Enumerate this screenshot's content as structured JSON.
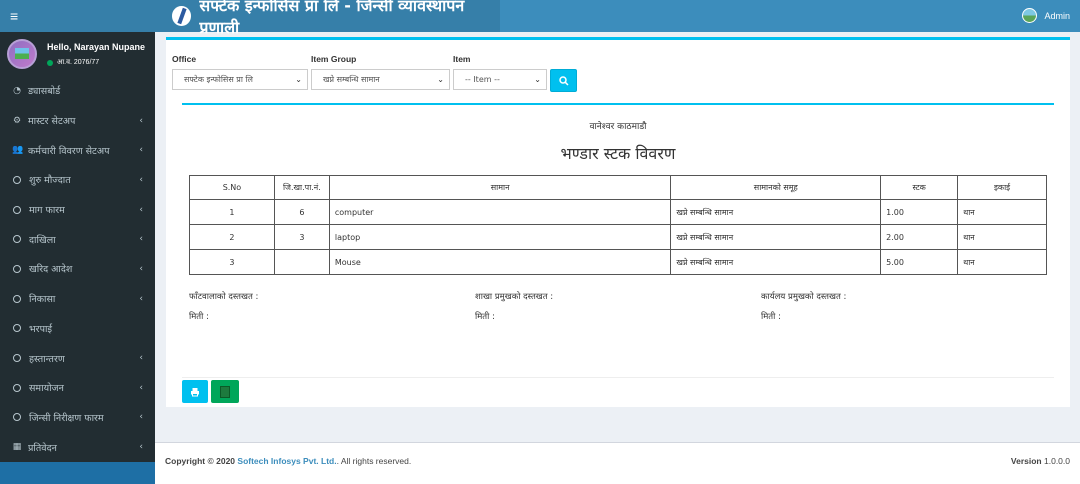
{
  "header": {
    "title": "सफ्टेक इन्फोसिस प्रा लि - जिन्सी व्यावस्थापन प्रणाली",
    "user": "Admin"
  },
  "sidebar": {
    "greeting": "Hello, Narayan Nupane",
    "fiscal_year": "आ.व. 2076/77",
    "items": [
      {
        "label": "ड्यासबोर्ड",
        "icon": "dashboard-icon",
        "chevron": false
      },
      {
        "label": "मास्टर सेटअप",
        "icon": "cogs-icon",
        "chevron": true
      },
      {
        "label": "कर्मचारी विवरण सेटअप",
        "icon": "users-icon",
        "chevron": true
      },
      {
        "label": "शुरु मौज्दात",
        "icon": "circle-icon",
        "chevron": true
      },
      {
        "label": "माग फारम",
        "icon": "circle-icon",
        "chevron": true
      },
      {
        "label": "दाखिला",
        "icon": "circle-icon",
        "chevron": true
      },
      {
        "label": "खरिद आदेश",
        "icon": "circle-icon",
        "chevron": true
      },
      {
        "label": "निकासा",
        "icon": "circle-icon",
        "chevron": true
      },
      {
        "label": "भरपाई",
        "icon": "circle-icon",
        "chevron": false
      },
      {
        "label": "हस्तान्तरण",
        "icon": "circle-icon",
        "chevron": true
      },
      {
        "label": "समायोजन",
        "icon": "circle-icon",
        "chevron": true
      },
      {
        "label": "जिन्सी निरीक्षण फारम",
        "icon": "circle-icon",
        "chevron": true
      },
      {
        "label": "प्रतिवेदन",
        "icon": "table-icon",
        "chevron": true
      }
    ]
  },
  "filters": {
    "office_label": "Office",
    "office_value": "सफ्टेक इन्फोसिस प्रा लि",
    "item_group_label": "Item Group",
    "item_group_value": "खप्ने सम्बन्धि सामान",
    "item_label": "Item",
    "item_value": "-- Item --"
  },
  "report": {
    "branch": "वानेश्वर काठमाडौ",
    "title": "भण्डार स्टक विवरण",
    "columns": [
      "S.No",
      "जि.खा.पा.नं.",
      "सामान",
      "सामानको समूह",
      "स्टक",
      "इकाई"
    ],
    "rows": [
      {
        "sno": "1",
        "ledger": "6",
        "item": "computer",
        "group": "खप्ने सम्बन्धि सामान",
        "stock": "1.00",
        "unit": "थान"
      },
      {
        "sno": "2",
        "ledger": "3",
        "item": "laptop",
        "group": "खप्ने सम्बन्धि सामान",
        "stock": "2.00",
        "unit": "थान"
      },
      {
        "sno": "3",
        "ledger": "",
        "item": "Mouse",
        "group": "खप्ने सम्बन्धि सामान",
        "stock": "5.00",
        "unit": "थान"
      }
    ],
    "signatures": {
      "s1": "फाँटवालाको दस्तखत :",
      "s2": "शाखा प्रमुखको दस्तखत :",
      "s3": "कार्यलय प्रमुखको दस्तखत :",
      "date": "मिती :"
    }
  },
  "footer": {
    "copyright_prefix": "Copyright © 2020",
    "company": "Softech Infosys Pvt. Ltd.",
    "rights": ". All rights reserved.",
    "version_label": "Version",
    "version_value": "1.0.0.0"
  },
  "colors": {
    "header": "#3c8dbc",
    "sidebar": "#222d32",
    "accent": "#00c0ef",
    "success": "#00a65a"
  }
}
